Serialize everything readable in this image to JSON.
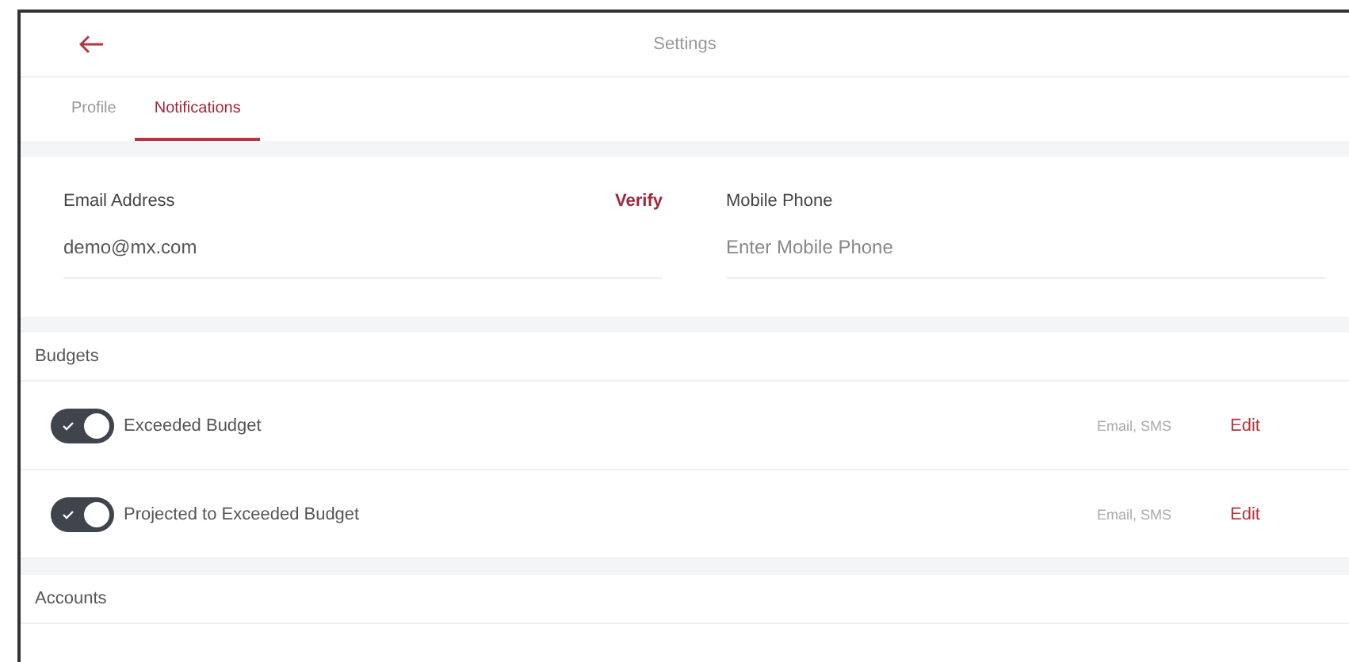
{
  "header": {
    "title": "Settings"
  },
  "tabs": [
    {
      "label": "Profile",
      "selected": false
    },
    {
      "label": "Notifications",
      "selected": true
    }
  ],
  "contact_fields": [
    {
      "label": "Email Address",
      "value": "demo@mx.com",
      "action": "Verify"
    },
    {
      "label": "Mobile Phone",
      "placeholder": "Enter Mobile Phone"
    }
  ],
  "sections": [
    {
      "title": "Budgets",
      "items": [
        {
          "label": "Exceeded Budget",
          "on": true,
          "channels": "Email, SMS",
          "action": "Edit"
        },
        {
          "label": "Projected to Exceeded Budget",
          "on": true,
          "channels": "Email, SMS",
          "action": "Edit"
        }
      ]
    },
    {
      "title": "Accounts"
    }
  ]
}
